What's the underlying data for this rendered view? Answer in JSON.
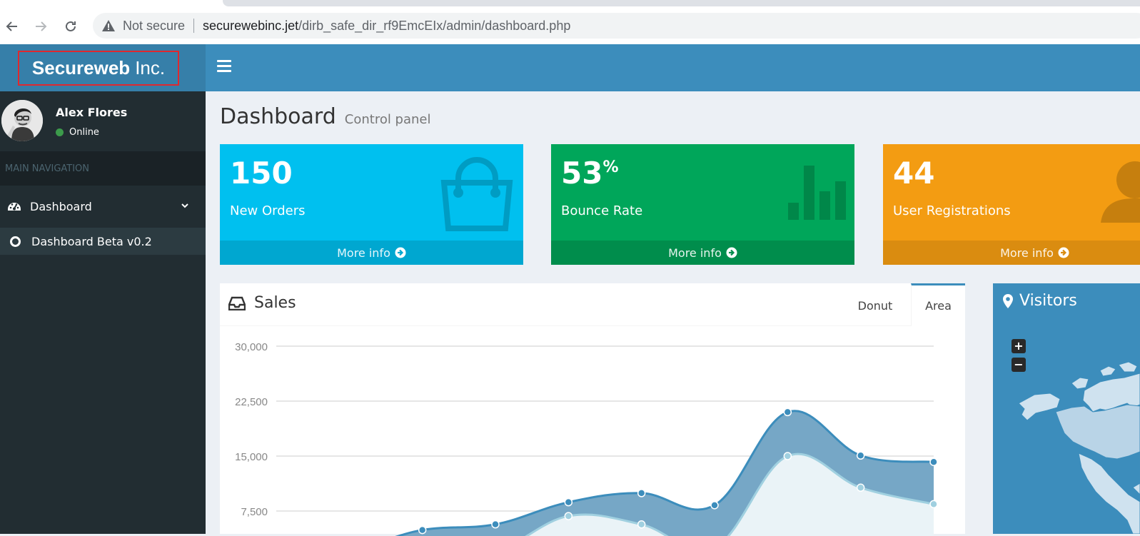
{
  "browser": {
    "security_label": "Not secure",
    "url_host": "securewebinc.jet",
    "url_path": "/dirb_safe_dir_rf9EmcEIx/admin/dashboard.php"
  },
  "header": {
    "logo_bold": "Secureweb",
    "logo_light": "Inc."
  },
  "sidebar": {
    "user_name": "Alex Flores",
    "user_status": "Online",
    "nav_header": "MAIN NAVIGATION",
    "items": [
      {
        "label": "Dashboard"
      },
      {
        "label": "Dashboard Beta v0.2"
      }
    ]
  },
  "page": {
    "title": "Dashboard",
    "subtitle": "Control panel"
  },
  "stats": [
    {
      "value": "150",
      "suffix": "",
      "label": "New Orders",
      "footer": "More info",
      "color": "#00c0ef",
      "icon": "shopping-bag-icon"
    },
    {
      "value": "53",
      "suffix": "%",
      "label": "Bounce Rate",
      "footer": "More info",
      "color": "#00a65a",
      "icon": "bar-chart-icon"
    },
    {
      "value": "44",
      "suffix": "",
      "label": "User Registrations",
      "footer": "More info",
      "color": "#f39c12",
      "icon": "user-icon"
    }
  ],
  "sales": {
    "title": "Sales",
    "tabs": [
      "Donut",
      "Area"
    ],
    "active_tab": "Area"
  },
  "visitors": {
    "title": "Visitors",
    "zoom_in": "+",
    "zoom_out": "−"
  },
  "colors": {
    "brand_dark": "#367fa9",
    "brand": "#3c8dbc",
    "sidebar": "#222d32"
  },
  "chart_data": {
    "type": "area",
    "y_ticks": [
      "30,000",
      "22,500",
      "15,000",
      "7,500"
    ],
    "ylim": [
      0,
      30000
    ],
    "series": [
      {
        "values": [
          2666,
          2294,
          4912,
          5683,
          8701,
          9945,
          8292,
          21000,
          15073,
          14200
        ]
      },
      {
        "values": [
          0,
          0,
          2600,
          1500,
          6810,
          5670,
          2500,
          15000,
          10687,
          8432
        ]
      }
    ]
  }
}
